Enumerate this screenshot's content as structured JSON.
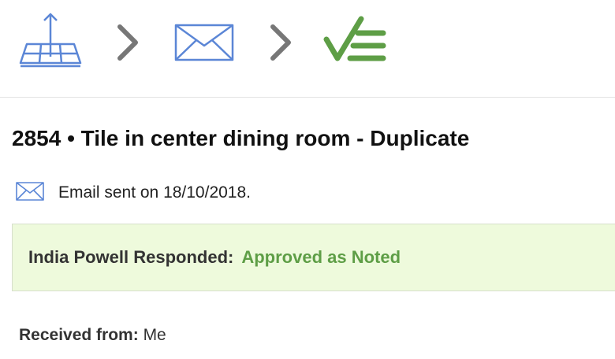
{
  "workflow": {
    "steps": [
      {
        "icon": "blueprint-upload-icon",
        "color": "#5b86d6"
      },
      {
        "icon": "chevron-right-icon",
        "color": "#777777"
      },
      {
        "icon": "envelope-icon",
        "color": "#5b86d6"
      },
      {
        "icon": "chevron-right-icon",
        "color": "#777777"
      },
      {
        "icon": "check-list-icon",
        "color": "#5e9e46"
      }
    ]
  },
  "item": {
    "title": "2854 • Tile in center dining room - Duplicate",
    "email_sent": "Email sent on 18/10/2018."
  },
  "response": {
    "label": "India Powell Responded:",
    "status": "Approved as Noted",
    "status_color": "#5e9e46",
    "background": "#eefadc"
  },
  "received": {
    "label": "Received from:",
    "value": "Me"
  }
}
